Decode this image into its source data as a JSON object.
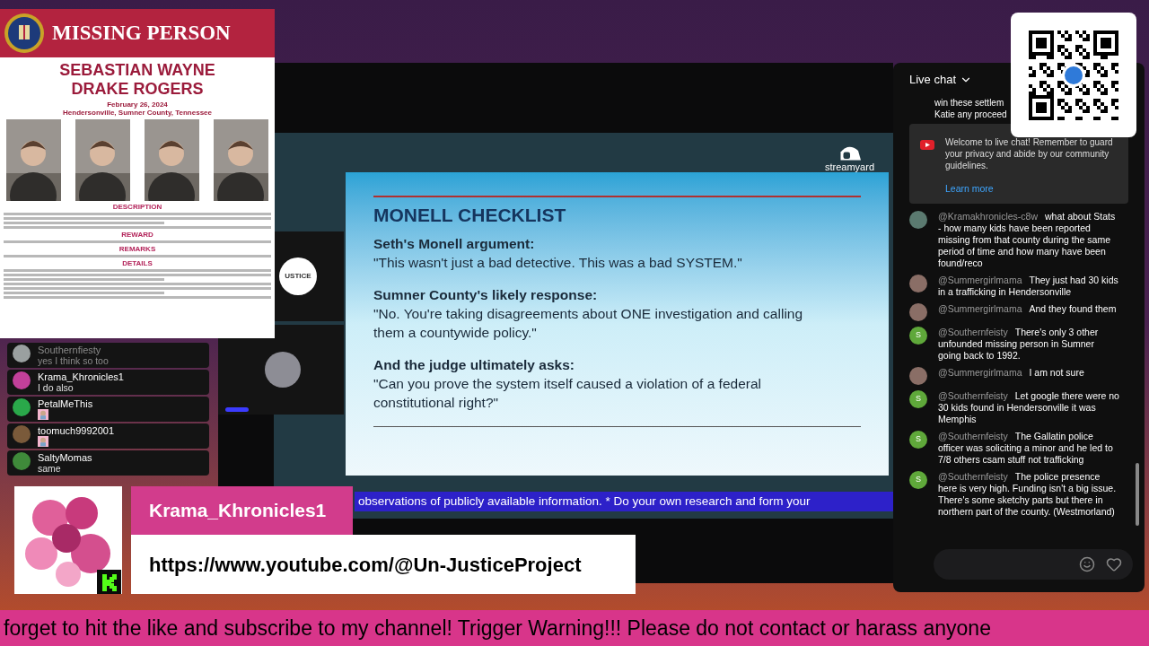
{
  "poster": {
    "header": "MISSING PERSON",
    "name": "SEBASTIAN WAYNE DRAKE ROGERS",
    "date": "February 26, 2024",
    "place": "Hendersonville, Sumner County, Tennessee",
    "sections": [
      {
        "title": "DESCRIPTION"
      },
      {
        "title": "REWARD"
      },
      {
        "title": "REMARKS"
      },
      {
        "title": "DETAILS"
      }
    ]
  },
  "stream": {
    "guest_label": "USTICE",
    "brand": "streamyard",
    "slide": {
      "title": "MONELL CHECKLIST",
      "sections": [
        {
          "heading": "Seth's Monell argument:",
          "quote": "\"This wasn't just a bad detective. This was a bad SYSTEM.\""
        },
        {
          "heading": "Sumner County's likely response:",
          "quote": "\"No. You're taking disagreements about ONE investigation and calling them a countywide policy.\""
        },
        {
          "heading": "And the judge ultimately asks:",
          "quote": "\"Can you prove the system itself caused a violation of a federal constitutional right?\""
        }
      ]
    },
    "ticker": "observations of publicly available information. * Do your own research and form your"
  },
  "host": {
    "name": "Krama_Khronicles1",
    "link": "https://www.youtube.com/@Un-JusticeProject"
  },
  "live_chat": {
    "title": "Live chat",
    "cut_lines": [
      "win these settlem",
      "Katie any proceed"
    ],
    "welcome": {
      "text": "Welcome to live chat! Remember to guard your privacy and abide by our community guidelines.",
      "link": "Learn more"
    },
    "messages": [
      {
        "author": "@Kramakhronicles-c8w",
        "text": "what about Stats - how many kids have been reported missing from that county during the same period of time and how many have been found/reco"
      },
      {
        "author": "@Summergirlmama",
        "text": "They just had 30 kids in a trafficking in Hendersonville"
      },
      {
        "author": "@Summergirlmama",
        "text": "And they found them"
      },
      {
        "author": "@Southernfeisty",
        "text": "There's only 3 other unfounded missing person in Sumner going back to 1992.",
        "avatar": {
          "kind": "initial",
          "initial": "S",
          "color": "#5fa83a"
        }
      },
      {
        "author": "@Summergirlmama",
        "text": "I am not sure"
      },
      {
        "author": "@Southernfeisty",
        "text": "Let google there were no 30 kids found in Hendersonville it was Memphis",
        "avatar": {
          "kind": "initial",
          "initial": "S",
          "color": "#5fa83a"
        }
      },
      {
        "author": "@Southernfeisty",
        "text": "The Gallatin police officer was soliciting a minor and he led to 7/8 others csam stuff not trafficking",
        "avatar": {
          "kind": "initial",
          "initial": "S",
          "color": "#5fa83a"
        }
      },
      {
        "author": "@Southernfeisty",
        "text": "The police presence here is very high. Funding isn't a big issue. There's some sketchy parts but there in northern part of the county. (Westmorland)",
        "avatar": {
          "kind": "initial",
          "initial": "S",
          "color": "#5fa83a"
        }
      }
    ]
  },
  "overlay_chat": [
    {
      "name": "Southernfiesty",
      "kind": "text",
      "text": "yes I think so too",
      "faded": true,
      "color": "#9aa0a0"
    },
    {
      "name": "Krama_Khronicles1",
      "kind": "text",
      "text": "I do also",
      "faded": false,
      "color": "#c2409a"
    },
    {
      "name": "PetalMeThis",
      "kind": "sticker",
      "faded": false,
      "color": "#2aa84a"
    },
    {
      "name": "toomuch9992001",
      "kind": "sticker",
      "faded": false,
      "color": "#7a5a3a"
    },
    {
      "name": "SaltyMomas",
      "kind": "text",
      "text": "same",
      "faded": false,
      "color": "#3f8a3a"
    }
  ],
  "bottom_ticker": "forget to hit the like and subscribe to my channel! Trigger Warning!!! Please do not contact or harass anyone"
}
